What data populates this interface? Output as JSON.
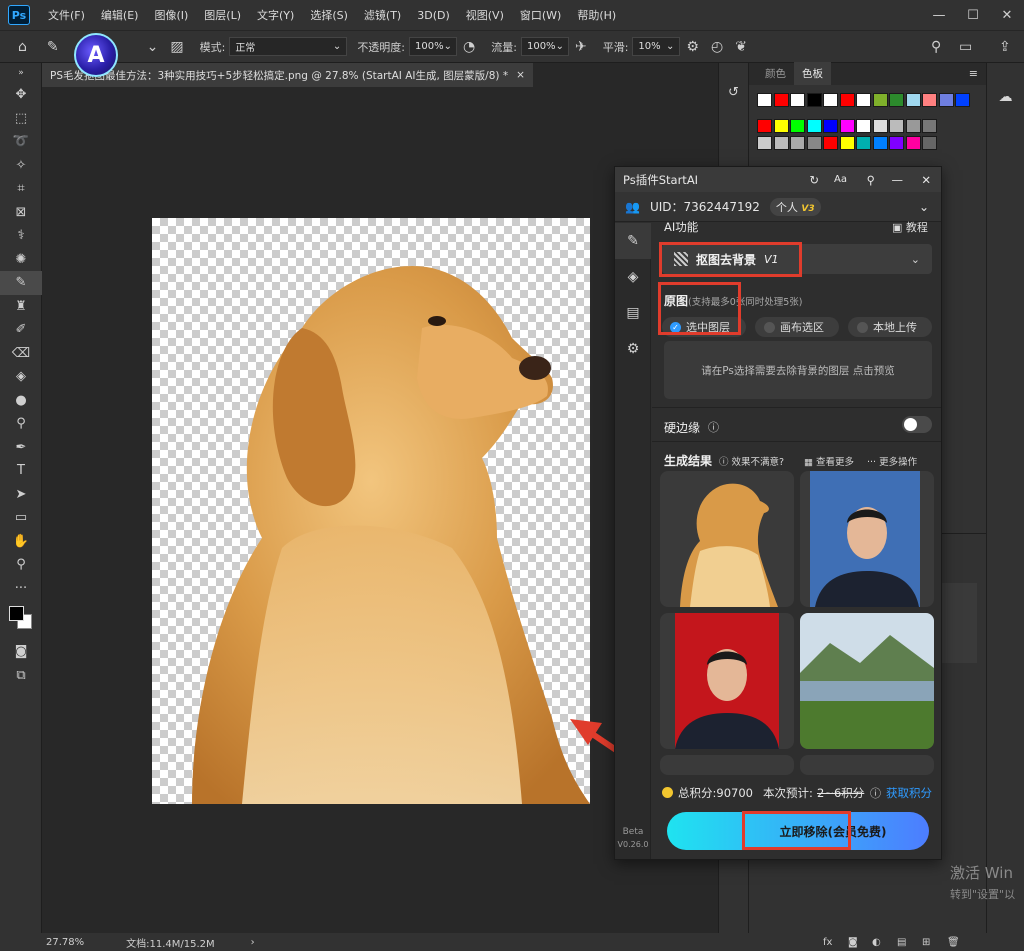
{
  "menubar": {
    "logo": "Ps",
    "items": [
      "文件(F)",
      "编辑(E)",
      "图像(I)",
      "图层(L)",
      "文字(Y)",
      "选择(S)",
      "滤镜(T)",
      "3D(D)",
      "视图(V)",
      "窗口(W)",
      "帮助(H)"
    ]
  },
  "optbar": {
    "mode_label": "模式:",
    "mode_value": "正常",
    "opacity_label": "不透明度:",
    "opacity_value": "100%",
    "flow_label": "流量:",
    "flow_value": "100%",
    "smooth_label": "平滑:",
    "smooth_value": "10%"
  },
  "doc": {
    "tab_title": "PS毛发抠图最佳方法：3种实用技巧+5步轻松搞定.png @ 27.8% (StartAI AI生成, 图层蒙版/8) *",
    "tab_close": "×"
  },
  "status": {
    "zoom": "27.78%",
    "doc_info": "文档:11.4M/15.2M"
  },
  "swatches": {
    "tab_color": "颜色",
    "tab_swatches": "色板",
    "row1": [
      "#ffffff",
      "#ff0000",
      "#ffffff",
      "#000000",
      "#ffffff",
      "#ff0000",
      "#ffffff",
      "#7fb02b",
      "#2c8a2c",
      "#a0d8ef",
      "#ff8080",
      "#6f7fe0",
      "#0040ff"
    ],
    "row2": [
      "#ff0000",
      "#ffff00",
      "#00ff00",
      "#00ffff",
      "#0000ff",
      "#ff00ff",
      "#ffffff",
      "#dddddd",
      "#bbbbbb",
      "#999999",
      "#777777"
    ],
    "row3": [
      "#cccccc",
      "#bbbbbb",
      "#aaaaaa",
      "#888888",
      "#ff0000",
      "#ffff00",
      "#00b0b0",
      "#0080ff",
      "#8000ff",
      "#ff00a0",
      "#666666"
    ]
  },
  "plugin": {
    "title": "Ps插件StartAI",
    "uid": "UID：7362447192",
    "plan": "个人",
    "plan_badge": "V3",
    "ai_func_label": "AI功能",
    "tutorial": "教程",
    "func_select": "抠图去背景",
    "func_version": "V1",
    "source_label": "原图",
    "source_hint": "(支持最多0张同时处理5张)",
    "seg_layer": "选中图层",
    "seg_canvas": "画布选区",
    "seg_upload": "本地上传",
    "placeholder": "请在Ps选择需要去除背景的图层 点击预览",
    "hard_edge": "硬边缘",
    "results_label": "生成结果",
    "unsatisfied": "效果不满意?",
    "view_more": "查看更多",
    "more_ops": "更多操作",
    "points": "总积分:90700",
    "estimate": "本次预计:",
    "estimate_value": "2~6积分",
    "get_points": "获取积分",
    "go_button": "立即移除(会员免费)",
    "beta": "Beta",
    "version": "V0.26.0"
  },
  "watermark": {
    "line1": "激活 Win",
    "line2": "转到\"设置\"以"
  },
  "colors": {
    "accent_red": "#e03c2c",
    "accent_blue": "#31a8ff",
    "gradient_start": "#1fe3f0",
    "gradient_end": "#4d7dff",
    "points_gold": "#f2c62f"
  }
}
